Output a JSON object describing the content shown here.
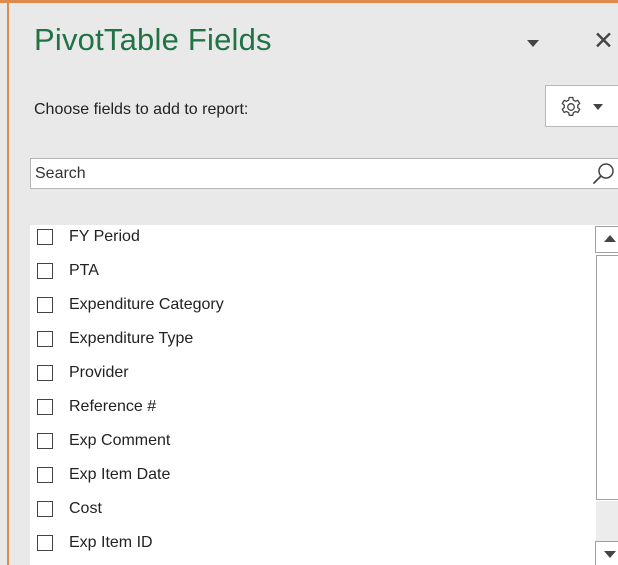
{
  "pane": {
    "title": "PivotTable Fields",
    "close_symbol": "✕",
    "choose_label": "Choose fields to add to report:",
    "accent_color": "#217346",
    "border_color": "#e08a4c"
  },
  "search": {
    "placeholder": "Search",
    "value": ""
  },
  "icons": {
    "options": "gear-icon",
    "search": "magnifier-icon",
    "pane_menu": "chevron-down-icon",
    "close": "close-icon"
  },
  "fields": [
    {
      "label": "FY Period",
      "checked": false
    },
    {
      "label": "PTA",
      "checked": false
    },
    {
      "label": "Expenditure Category",
      "checked": false
    },
    {
      "label": "Expenditure Type",
      "checked": false
    },
    {
      "label": "Provider",
      "checked": false
    },
    {
      "label": "Reference #",
      "checked": false
    },
    {
      "label": "Exp Comment",
      "checked": false
    },
    {
      "label": "Exp Item Date",
      "checked": false
    },
    {
      "label": "Cost",
      "checked": false
    },
    {
      "label": "Exp Item ID",
      "checked": false
    }
  ]
}
